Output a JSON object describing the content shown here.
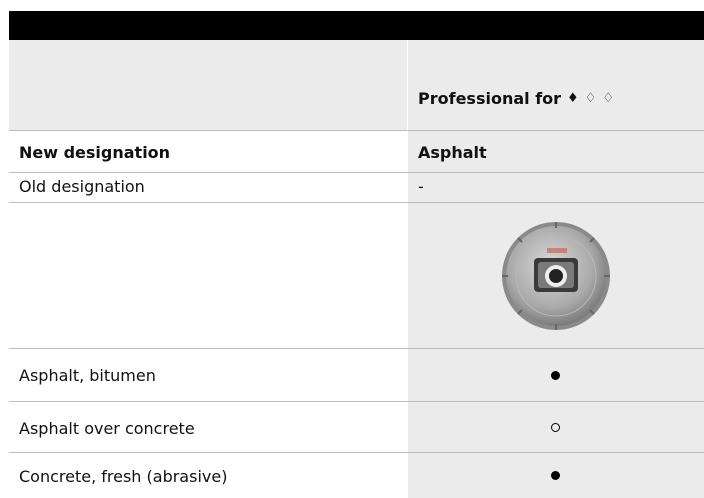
{
  "header": {
    "product_name": "Professional for",
    "gem_icons": [
      "diamond-filled-icon",
      "diamond-outline-icon",
      "diamond-outline-icon"
    ],
    "gem_glyphs": [
      "♦",
      "♢",
      "♢"
    ]
  },
  "rows": {
    "new_designation": {
      "label": "New designation",
      "value": "Asphalt"
    },
    "old_designation": {
      "label": "Old designation",
      "value": "-"
    },
    "image": {
      "icon": "diamond-cutting-blade-image"
    },
    "applications": [
      {
        "label": "Asphalt, bitumen",
        "suitability": "filled"
      },
      {
        "label": "Asphalt over concrete",
        "suitability": "open"
      },
      {
        "label": "Concrete, fresh (abrasive)",
        "suitability": "filled"
      }
    ]
  }
}
